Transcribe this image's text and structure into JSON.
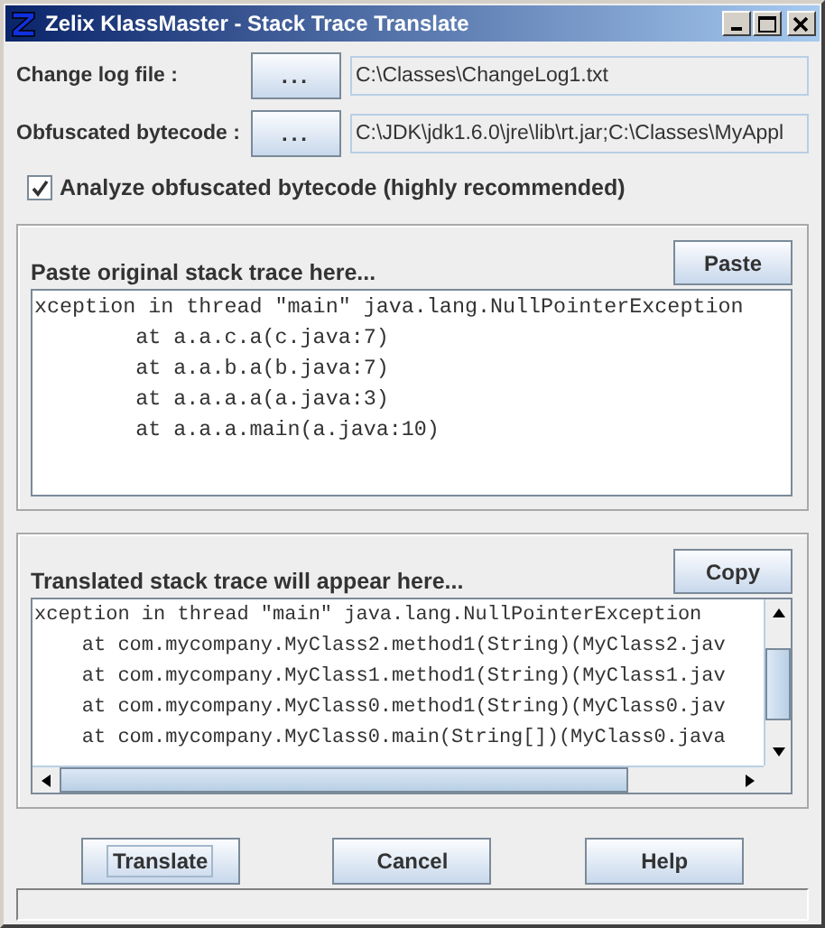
{
  "window": {
    "title": "Zelix KlassMaster - Stack Trace Translate"
  },
  "file_rows": [
    {
      "label": "Change log file :",
      "button": "...",
      "value": "C:\\Classes\\ChangeLog1.txt"
    },
    {
      "label": "Obfuscated bytecode :",
      "button": "...",
      "value": "C:\\JDK\\jdk1.6.0\\jre\\lib\\rt.jar;C:\\Classes\\MyAppl"
    }
  ],
  "analyze_checkbox": {
    "label": "Analyze obfuscated bytecode (highly recommended)",
    "checked": true
  },
  "original_panel": {
    "label": "Paste original stack trace here...",
    "button": "Paste",
    "lines": [
      "xception in thread \"main\" java.lang.NullPointerException",
      "        at a.a.c.a(c.java:7)",
      "        at a.a.b.a(b.java:7)",
      "        at a.a.a.a(a.java:3)",
      "        at a.a.a.main(a.java:10)"
    ]
  },
  "translated_panel": {
    "label": "Translated stack trace will appear here...",
    "button": "Copy",
    "lines": [
      "xception in thread \"main\" java.lang.NullPointerException",
      "    at com.mycompany.MyClass2.method1(String)(MyClass2.jav",
      "    at com.mycompany.MyClass1.method1(String)(MyClass1.jav",
      "    at com.mycompany.MyClass0.method1(String)(MyClass0.jav",
      "    at com.mycompany.MyClass0.main(String[])(MyClass0.java"
    ]
  },
  "buttons": [
    {
      "label": "Translate",
      "focused": true
    },
    {
      "label": "Cancel",
      "focused": false
    },
    {
      "label": "Help",
      "focused": false
    }
  ]
}
